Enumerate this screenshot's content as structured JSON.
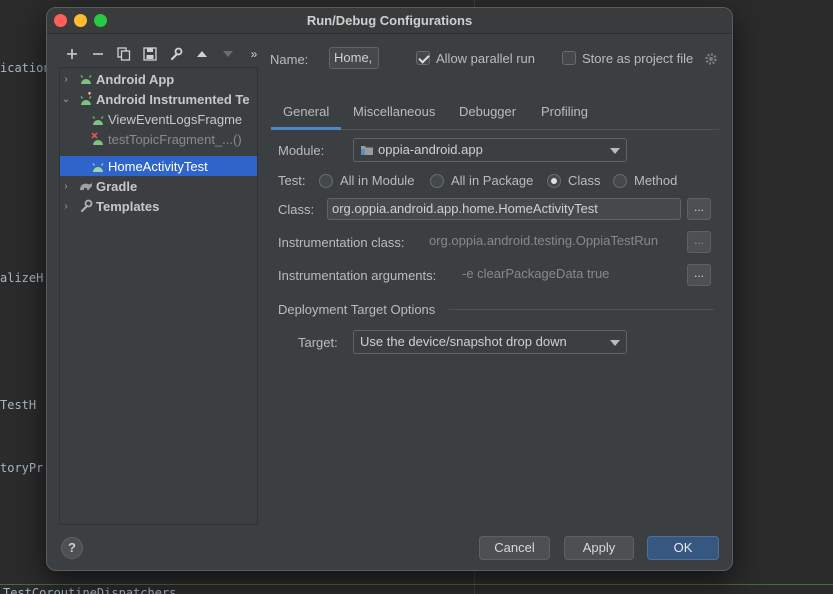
{
  "editor": {
    "lines": [
      "ication",
      "alizeH",
      "TestH",
      "toryPr"
    ],
    "bottom": "TestCoroutineDispatchers"
  },
  "dialog": {
    "title": "Run/Debug Configurations"
  },
  "tree": {
    "items": [
      {
        "label": "Android App",
        "bold": true,
        "expanded": false
      },
      {
        "label": "Android Instrumented Te",
        "bold": true,
        "expanded": true
      },
      {
        "label": "ViewEventLogsFragme",
        "bold": false
      },
      {
        "label": "testTopicFragment_...()",
        "bold": false,
        "disabled": true
      },
      {
        "label": "HomeActivityTest",
        "bold": false,
        "selected": true
      },
      {
        "label": "Gradle",
        "bold": true,
        "expanded": false
      },
      {
        "label": "Templates",
        "bold": true,
        "expanded": false
      }
    ]
  },
  "form": {
    "name_label": "Name:",
    "name_value": "Home,",
    "allow_parallel_label": "Allow parallel run",
    "allow_parallel_checked": true,
    "store_project_label": "Store as project file",
    "store_project_checked": false,
    "tabs": [
      "General",
      "Miscellaneous",
      "Debugger",
      "Profiling"
    ],
    "active_tab": "General",
    "module_label": "Module:",
    "module_value": "oppia-android.app",
    "test_label": "Test:",
    "test_options": [
      "All in Module",
      "All in Package",
      "Class",
      "Method"
    ],
    "test_selected": "Class",
    "class_label": "Class:",
    "class_value": "org.oppia.android.app.home.HomeActivityTest",
    "instr_class_label": "Instrumentation class:",
    "instr_class_value": "org.oppia.android.testing.OppiaTestRun",
    "instr_args_label": "Instrumentation arguments:",
    "instr_args_value": "-e clearPackageData true",
    "deploy_section": "Deployment Target Options",
    "target_label": "Target:",
    "target_value": "Use the device/snapshot drop down",
    "browse": "..."
  },
  "buttons": {
    "help": "?",
    "cancel": "Cancel",
    "apply": "Apply",
    "ok": "OK"
  },
  "colors": {
    "accent": "#2f65ca",
    "android_green": "#7cc47f"
  }
}
